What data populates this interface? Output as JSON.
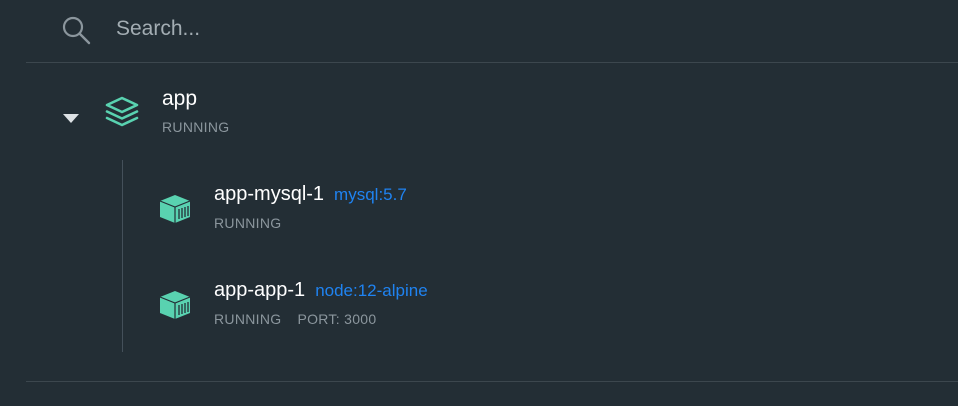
{
  "search": {
    "placeholder": "Search...",
    "value": ""
  },
  "app": {
    "name": "app",
    "status": "RUNNING",
    "expanded": true,
    "containers": [
      {
        "name": "app-mysql-1",
        "image": "mysql:5.7",
        "status": "RUNNING",
        "port": ""
      },
      {
        "name": "app-app-1",
        "image": "node:12-alpine",
        "status": "RUNNING",
        "port": "PORT: 3000"
      }
    ]
  },
  "icons": {
    "search": "search-icon",
    "caret": "caret-down-icon",
    "app": "stack-icon",
    "container": "container-icon"
  },
  "colors": {
    "background": "#232e35",
    "accent": "#59d2b0",
    "link": "#1f83f1",
    "muted": "#8b969d"
  }
}
